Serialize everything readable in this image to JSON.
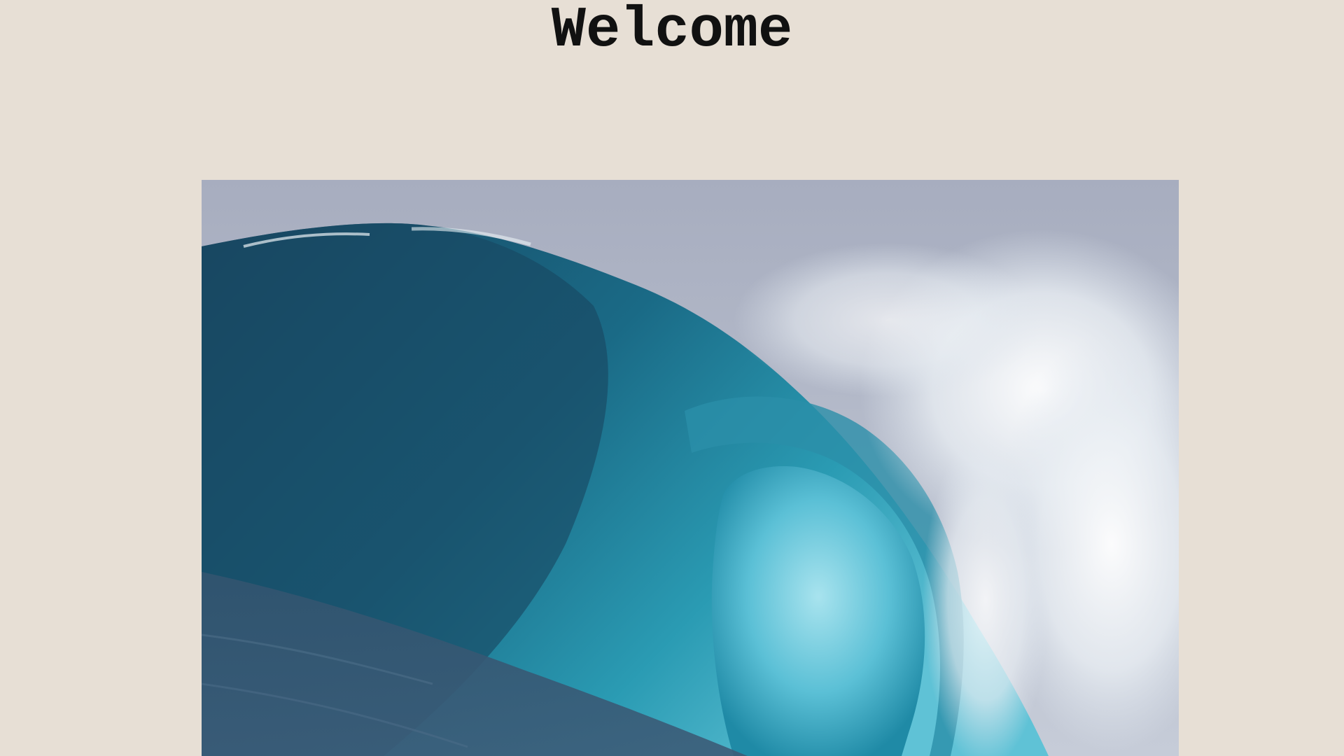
{
  "page": {
    "title": "Welcome",
    "background_color": "#e7dfd5"
  },
  "hero_image": {
    "subject": "ocean-wave-photo",
    "colors": {
      "sky": "#9ea6b8",
      "deep_water": "#1f4f6a",
      "mid_water": "#1e7e98",
      "tube_light": "#7fcfe0",
      "foam": "#f3f6f8",
      "sea_surface": "#2f4e68"
    }
  }
}
